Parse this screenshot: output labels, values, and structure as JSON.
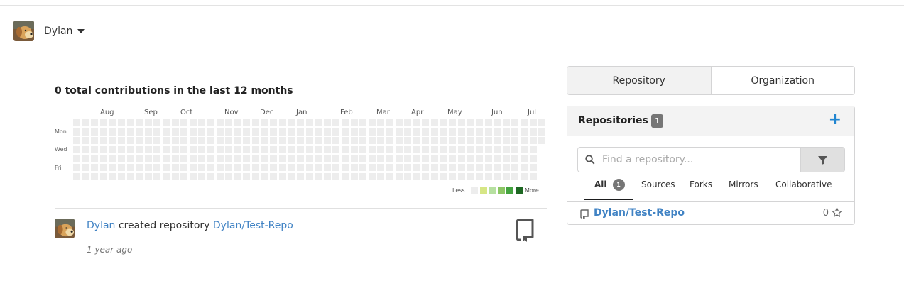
{
  "context": {
    "user_name": "Dylan"
  },
  "heatmap": {
    "title": "0 total contributions in the last 12 months",
    "months": [
      "Aug",
      "Sep",
      "Oct",
      "Nov",
      "Dec",
      "Jan",
      "Feb",
      "Mar",
      "Apr",
      "May",
      "Jun",
      "Jul"
    ],
    "days": [
      "Mon",
      "Wed",
      "Fri"
    ],
    "legend_less": "Less",
    "legend_more": "More",
    "legend_colors": [
      "#ededed",
      "#d6e685",
      "#b6e0a0",
      "#8cc665",
      "#44a340",
      "#1e6823"
    ],
    "empty_color": "#ededed"
  },
  "feed": {
    "user": "Dylan",
    "action": " created repository ",
    "repo": "Dylan/Test-Repo",
    "time": "1 year ago",
    "icon": "repo-icon"
  },
  "panel": {
    "tabs": [
      "Repository",
      "Organization"
    ],
    "title": "Repositories",
    "count": "1",
    "search_placeholder": "Find a repository...",
    "filters": [
      {
        "label": "All",
        "count": "1"
      },
      {
        "label": "Sources"
      },
      {
        "label": "Forks"
      },
      {
        "label": "Mirrors"
      },
      {
        "label": "Collaborative"
      }
    ],
    "repos": [
      {
        "name": "Dylan/Test-Repo",
        "stars": "0"
      }
    ]
  },
  "colors": {
    "link": "#4183c4",
    "accent": "#2185d0",
    "badge": "#767676"
  }
}
